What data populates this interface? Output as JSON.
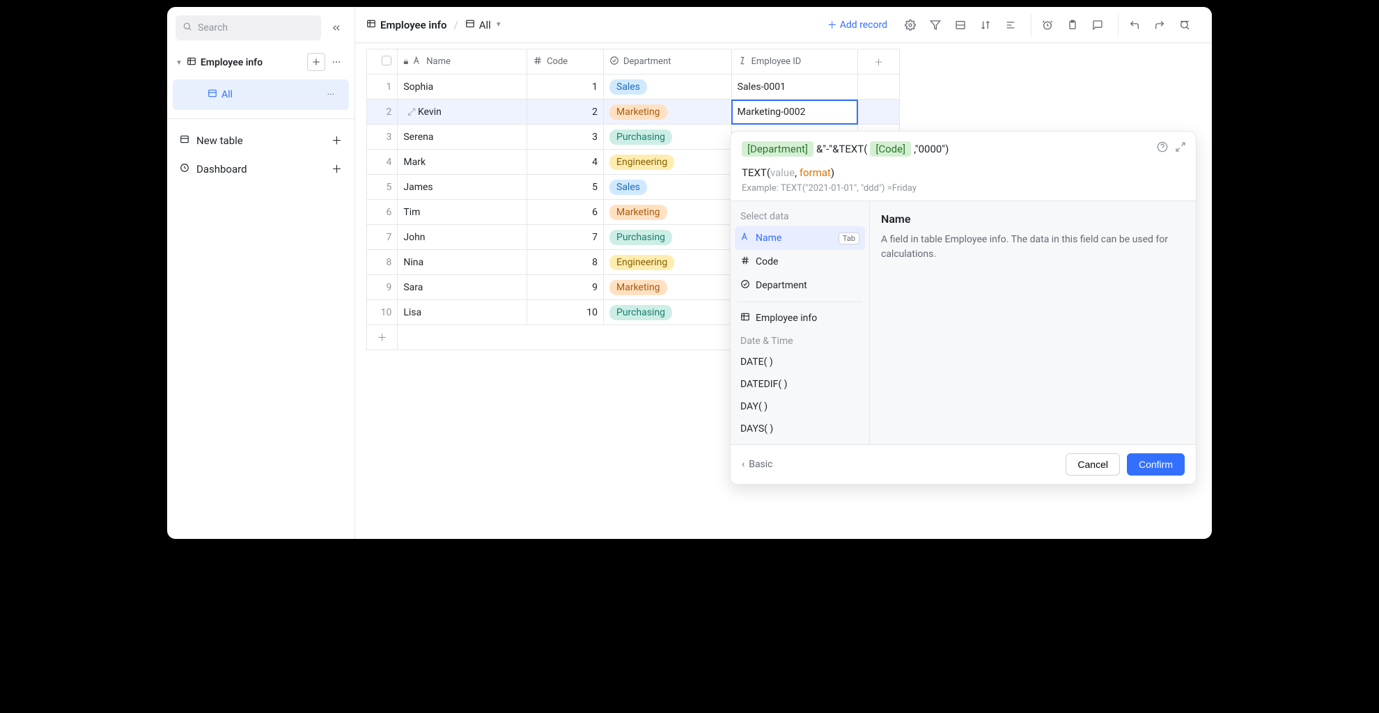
{
  "sidebar": {
    "search_placeholder": "Search",
    "table_name": "Employee info",
    "view_name": "All",
    "new_table": "New table",
    "dashboard": "Dashboard"
  },
  "toolbar": {
    "crumb_table": "Employee info",
    "crumb_view": "All",
    "add_record": "Add record"
  },
  "columns": {
    "name": "Name",
    "code": "Code",
    "dept": "Department",
    "empid": "Employee ID"
  },
  "rows": [
    {
      "idx": "1",
      "name": "Sophia",
      "code": "1",
      "dept": "Sales",
      "dept_cls": "sales",
      "empid": "Sales-0001"
    },
    {
      "idx": "2",
      "name": "Kevin",
      "code": "2",
      "dept": "Marketing",
      "dept_cls": "marketing",
      "empid": "Marketing-0002"
    },
    {
      "idx": "3",
      "name": "Serena",
      "code": "3",
      "dept": "Purchasing",
      "dept_cls": "purchasing",
      "empid": ""
    },
    {
      "idx": "4",
      "name": "Mark",
      "code": "4",
      "dept": "Engineering",
      "dept_cls": "engineering",
      "empid": ""
    },
    {
      "idx": "5",
      "name": "James",
      "code": "5",
      "dept": "Sales",
      "dept_cls": "sales",
      "empid": ""
    },
    {
      "idx": "6",
      "name": "Tim",
      "code": "6",
      "dept": "Marketing",
      "dept_cls": "marketing",
      "empid": ""
    },
    {
      "idx": "7",
      "name": "John",
      "code": "7",
      "dept": "Purchasing",
      "dept_cls": "purchasing",
      "empid": ""
    },
    {
      "idx": "8",
      "name": "Nina",
      "code": "8",
      "dept": "Engineering",
      "dept_cls": "engineering",
      "empid": ""
    },
    {
      "idx": "9",
      "name": "Sara",
      "code": "9",
      "dept": "Marketing",
      "dept_cls": "marketing",
      "empid": ""
    },
    {
      "idx": "10",
      "name": "Lisa",
      "code": "10",
      "dept": "Purchasing",
      "dept_cls": "purchasing",
      "empid": ""
    }
  ],
  "popover": {
    "chip_dept": "[Department]",
    "chip_code": "[Code]",
    "formula_mid": "&\"-\"&TEXT(",
    "formula_end": ",\"0000\")",
    "hint_fn": "TEXT(",
    "hint_v": "value",
    "hint_comma": ", ",
    "hint_fmt": "format",
    "hint_close": ")",
    "example": "Example: TEXT(\"2021-01-01\", \"ddd\") =Friday",
    "sec_select": "Select data",
    "opt_name": "Name",
    "opt_tab": "Tab",
    "opt_code": "Code",
    "opt_dept": "Department",
    "opt_emp": "Employee info",
    "sec_date": "Date & Time",
    "fn_date": "DATE( )",
    "fn_datedif": "DATEDIF( )",
    "fn_day": "DAY( )",
    "fn_days": "DAYS( )",
    "detail_title": "Name",
    "detail_body": "A field in table Employee info. The data in this field can be used for calculations.",
    "back": "Basic",
    "cancel": "Cancel",
    "confirm": "Confirm"
  }
}
